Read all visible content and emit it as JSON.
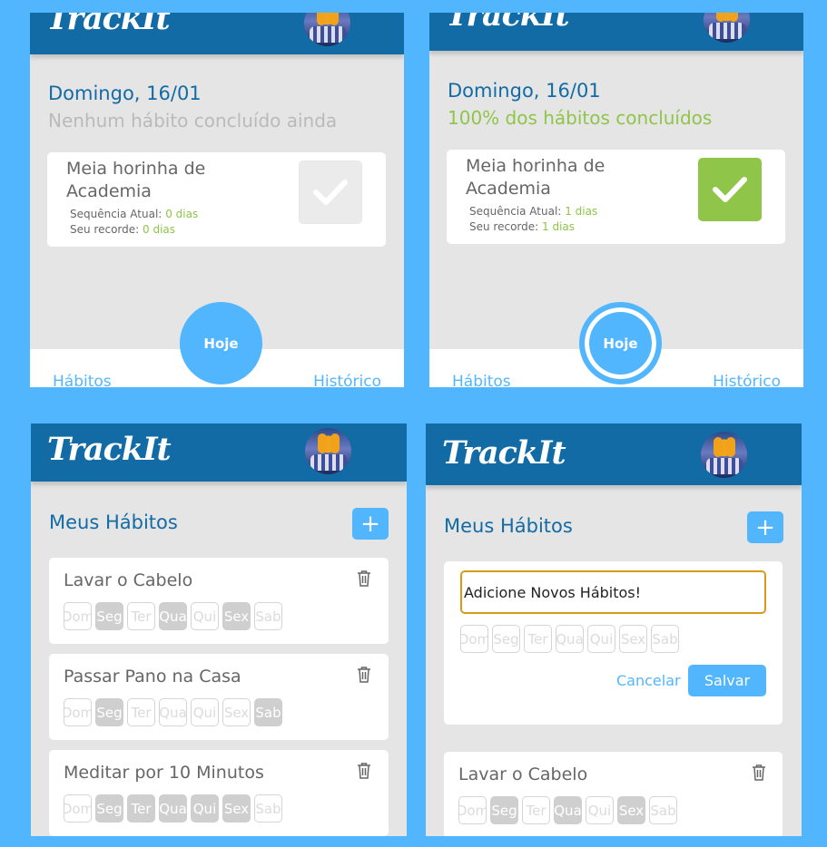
{
  "app": {
    "logo": "TrackIt"
  },
  "today_screens": [
    {
      "date": "Domingo, 16/01",
      "subtitle": "Nenhum hábito concluído ainda",
      "habit": {
        "name": "Meia horinha de Academia",
        "streak_label": "Sequência Atual:",
        "streak_value": "0 dias",
        "record_label": "Seu recorde:",
        "record_value": "0 dias",
        "done": false
      }
    },
    {
      "date": "Domingo, 16/01",
      "subtitle": "100% dos hábitos concluídos",
      "habit": {
        "name": "Meia horinha de Academia",
        "streak_label": "Sequência Atual:",
        "streak_value": "1 dias",
        "record_label": "Seu recorde:",
        "record_value": "1 dias",
        "done": true
      }
    }
  ],
  "footer": {
    "habits": "Hábitos",
    "today": "Hoje",
    "history": "Histórico"
  },
  "habits_screen": {
    "title": "Meus Hábitos",
    "add_label": "+",
    "weekdays": [
      "Dom",
      "Seg",
      "Ter",
      "Qua",
      "Qui",
      "Sex",
      "Sab"
    ],
    "habits": [
      {
        "name": "Lavar o Cabelo",
        "selected": [
          1,
          3,
          5
        ]
      },
      {
        "name": "Passar Pano na Casa",
        "selected": [
          1,
          6
        ]
      },
      {
        "name": "Meditar por 10 Minutos",
        "selected": [
          1,
          2,
          3,
          4,
          5
        ]
      }
    ]
  },
  "new_habit": {
    "input_value": "Adicione Novos Hábitos!",
    "cancel": "Cancelar",
    "save": "Salvar"
  },
  "colors": {
    "brand": "#126ba5",
    "accent": "#52b6ff",
    "success": "#8fc549",
    "background": "#e5e5e5"
  }
}
